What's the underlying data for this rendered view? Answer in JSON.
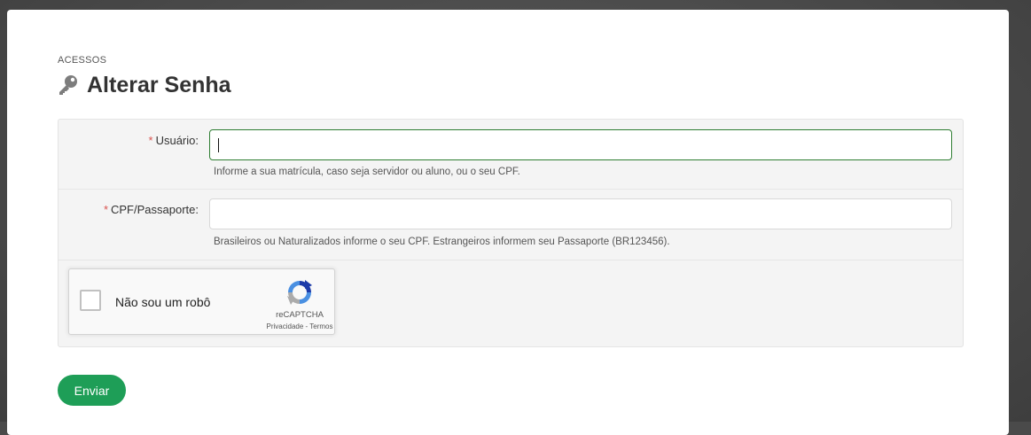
{
  "breadcrumb": "ACESSOS",
  "page_title": "Alterar Senha",
  "form": {
    "username": {
      "required_mark": "*",
      "label": "Usuário:",
      "value": "",
      "help": "Informe a sua matrícula, caso seja servidor ou aluno, ou o seu CPF."
    },
    "cpf": {
      "required_mark": "*",
      "label": "CPF/Passaporte:",
      "value": "",
      "help": "Brasileiros ou Naturalizados informe o seu CPF. Estrangeiros informem seu Passaporte (BR123456)."
    }
  },
  "recaptcha": {
    "label": "Não sou um robô",
    "brand": "reCAPTCHA",
    "links": "Privacidade - Termos"
  },
  "submit_label": "Enviar",
  "colors": {
    "accent": "#1e9e57",
    "focus_border": "#2e7d32",
    "required": "#d9534f"
  },
  "icons": {
    "title_icon": "key-icon",
    "recaptcha_icon": "recaptcha-logo-icon"
  }
}
